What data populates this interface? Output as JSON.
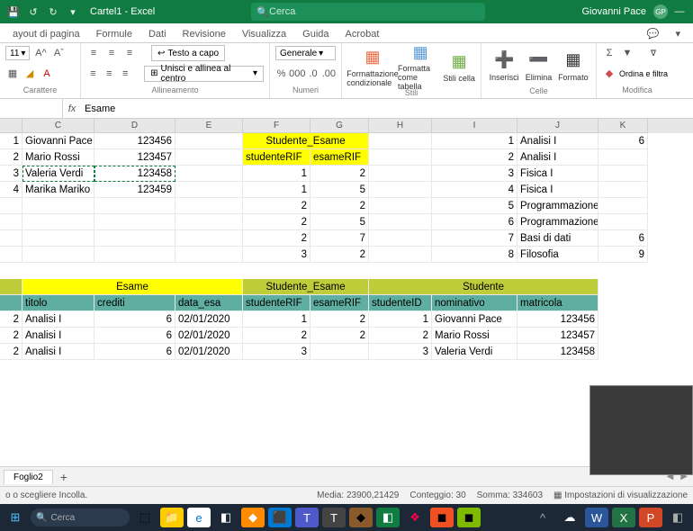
{
  "title": "Cartel1 - Excel",
  "search_placeholder": "Cerca",
  "user_name": "Giovanni Pace",
  "user_initials": "GP",
  "tabs": [
    "ayout di pagina",
    "Formule",
    "Dati",
    "Revisione",
    "Visualizza",
    "Guida",
    "Acrobat"
  ],
  "ribbon": {
    "font_size": "11",
    "wrap_text": "Testo a capo",
    "merge_center": "Unisci e allinea al centro",
    "number_fmt": "Generale",
    "groups": {
      "font": "Carattere",
      "align": "Allineamento",
      "num": "Numeri",
      "styles": "Stili",
      "cells": "Celle",
      "edit": "Modifica"
    },
    "cond_fmt": "Formattazione condizionale",
    "fmt_table": "Formatta come tabella",
    "cell_styles": "Stili cella",
    "insert": "Inserisci",
    "delete": "Elimina",
    "format": "Formato",
    "sort": "Ordina e filtra"
  },
  "namebox": "",
  "formula_value": "Esame",
  "col_headers": [
    "C",
    "D",
    "E",
    "F",
    "G",
    "H",
    "I",
    "J",
    "K"
  ],
  "students": [
    {
      "row": "1",
      "name": "Giovanni Pace",
      "num": "123456"
    },
    {
      "row": "2",
      "name": "Mario Rossi",
      "num": "123457"
    },
    {
      "row": "3",
      "name": "Valeria Verdi",
      "num": "123458"
    },
    {
      "row": "4",
      "name": "Marika Mariko",
      "num": "123459"
    }
  ],
  "se_title": "Studente_Esame",
  "se_h1": "studenteRIF",
  "se_h2": "esameRIF",
  "se_rows": [
    [
      "1",
      "2"
    ],
    [
      "1",
      "5"
    ],
    [
      "2",
      "2"
    ],
    [
      "2",
      "5"
    ],
    [
      "2",
      "7"
    ],
    [
      "3",
      "2"
    ]
  ],
  "exams_right": [
    {
      "i": "1",
      "n": "Analisi I",
      "c": "6"
    },
    {
      "i": "2",
      "n": "Analisi I",
      "c": ""
    },
    {
      "i": "3",
      "n": "Fisica I",
      "c": ""
    },
    {
      "i": "4",
      "n": "Fisica I",
      "c": ""
    },
    {
      "i": "5",
      "n": "Programmazione",
      "c": ""
    },
    {
      "i": "6",
      "n": "Programmazione",
      "c": ""
    },
    {
      "i": "7",
      "n": "Basi di dati",
      "c": "6"
    },
    {
      "i": "8",
      "n": "Filosofia",
      "c": "9"
    }
  ],
  "lower_hdr": {
    "esame": "Esame",
    "se": "Studente_Esame",
    "studente": "Studente"
  },
  "lower_cols": {
    "titolo": "titolo",
    "crediti": "crediti",
    "data": "data_esa",
    "sr": "studenteRIF",
    "er": "esameRIF",
    "sid": "studenteID",
    "nom": "nominativo",
    "mat": "matricola"
  },
  "lower_rows": [
    {
      "b": "2",
      "t": "Analisi I",
      "c": "6",
      "d": "02/01/2020",
      "sr": "1",
      "er": "2",
      "sid": "1",
      "nom": "Giovanni Pace",
      "mat": "123456"
    },
    {
      "b": "2",
      "t": "Analisi I",
      "c": "6",
      "d": "02/01/2020",
      "sr": "2",
      "er": "2",
      "sid": "2",
      "nom": "Mario Rossi",
      "mat": "123457"
    },
    {
      "b": "2",
      "t": "Analisi I",
      "c": "6",
      "d": "02/01/2020",
      "sr": "3",
      "er": "",
      "sid": "3",
      "nom": "Valeria Verdi",
      "mat": "123458"
    }
  ],
  "sheet_tab": "Foglio2",
  "status_msg": "o o scegliere Incolla.",
  "status_media": "Media: 23900,21429",
  "status_count": "Conteggio: 30",
  "status_sum": "Somma: 334603",
  "status_disp": "Impostazioni di visualizzazione",
  "taskbar_search": "Cerca"
}
